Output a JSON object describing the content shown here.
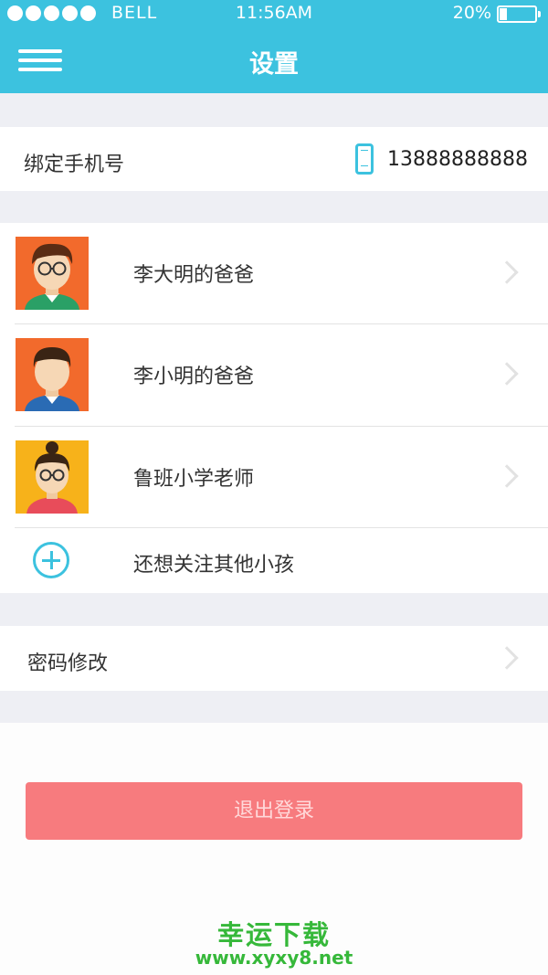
{
  "status_bar": {
    "carrier": "BELL",
    "time": "11:56AM",
    "battery": "20%",
    "battery_level": 0.2
  },
  "header": {
    "title": "设置",
    "menu_icon": "hamburger-menu-icon",
    "background_color": "#3cc2df"
  },
  "phone": {
    "label": "绑定手机号",
    "icon": "mobile-phone-icon",
    "number": "13888888888"
  },
  "children": [
    {
      "name": "李大明的爸爸",
      "avatar": "boy-glasses-avatar"
    },
    {
      "name": "李小明的爸爸",
      "avatar": "boy-avatar"
    },
    {
      "name": "鲁班小学老师",
      "avatar": "woman-teacher-avatar"
    }
  ],
  "add_child": {
    "icon": "plus-circle-icon",
    "label": "还想关注其他小孩"
  },
  "password": {
    "label": "密码修改"
  },
  "logout": {
    "label": "退出登录",
    "color": "#f77b7e"
  },
  "watermark": {
    "title": "幸运下载",
    "url": "www.xyxy8.net",
    "color": "#36b83a"
  }
}
